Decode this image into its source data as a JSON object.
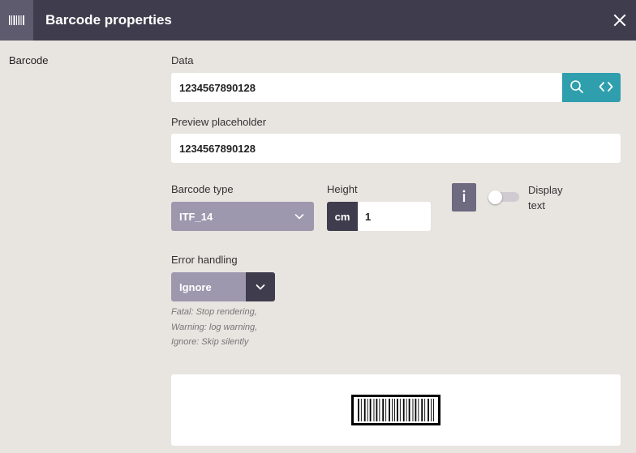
{
  "header": {
    "title": "Barcode properties",
    "icon": "barcode-icon",
    "close_icon": "close-icon"
  },
  "sidebar": {
    "section": "Barcode"
  },
  "data_field": {
    "label": "Data",
    "value": "1234567890128",
    "search_icon": "search-icon",
    "code_icon": "code-icon"
  },
  "preview_placeholder": {
    "label": "Preview placeholder",
    "value": "1234567890128"
  },
  "barcode_type": {
    "label": "Barcode type",
    "value": "ITF_14"
  },
  "height": {
    "label": "Height",
    "unit": "cm",
    "value": "1"
  },
  "display_text": {
    "label": "Display text",
    "enabled": false,
    "info_icon": "info-icon"
  },
  "error_handling": {
    "label": "Error handling",
    "value": "Ignore",
    "help_lines": [
      "Fatal: Stop rendering,",
      "Warning: log warning,",
      "Ignore: Skip silently"
    ]
  },
  "preview": {
    "value": "1234567890128"
  },
  "colors": {
    "header": "#3f3d4d",
    "accent": "#2f9fad",
    "select": "#9d98ae",
    "background": "#e8e4e0"
  }
}
